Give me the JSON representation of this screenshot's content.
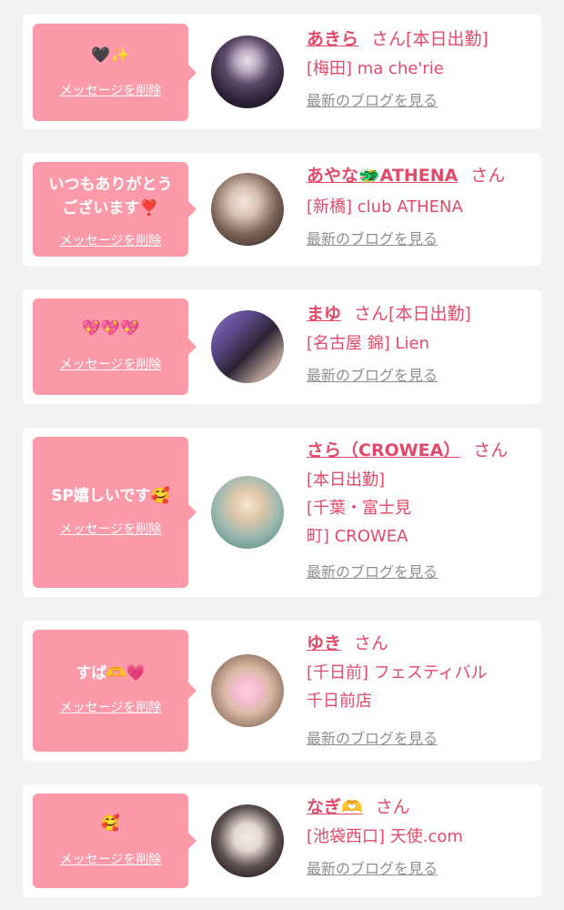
{
  "common": {
    "delete_label": "メッセージを削除",
    "blog_label": "最新のブログを見る",
    "san": "さん"
  },
  "cards": [
    {
      "message": "🖤✨",
      "name": "あきら",
      "after_name": "[本日出勤]",
      "shop_lines": [
        "[梅田] ma che'rie"
      ]
    },
    {
      "message_lines": [
        "いつもありがとう",
        "ございます❣️"
      ],
      "name": "あやな🐲ATHENA",
      "shop_lines": [
        "[新橋] club ATHENA"
      ]
    },
    {
      "message": "💖💖💖",
      "name": "まゆ",
      "after_name": "[本日出勤]",
      "shop_lines": [
        "[名古屋 錦] Lien"
      ]
    },
    {
      "message": "SP嬉しいです🥰",
      "name": "さら（CROWEA）",
      "shop_lines": [
        "[本日出勤]",
        "[千葉・富士見",
        "町] CROWEA"
      ]
    },
    {
      "message": "すば🫶💗",
      "name": "ゆき",
      "shop_lines": [
        "[千日前] フェスティバル",
        "千日前店"
      ]
    },
    {
      "message": "🥰",
      "name": "なぎ🫶",
      "shop_lines": [
        "[池袋西口] 天使.com"
      ]
    }
  ]
}
